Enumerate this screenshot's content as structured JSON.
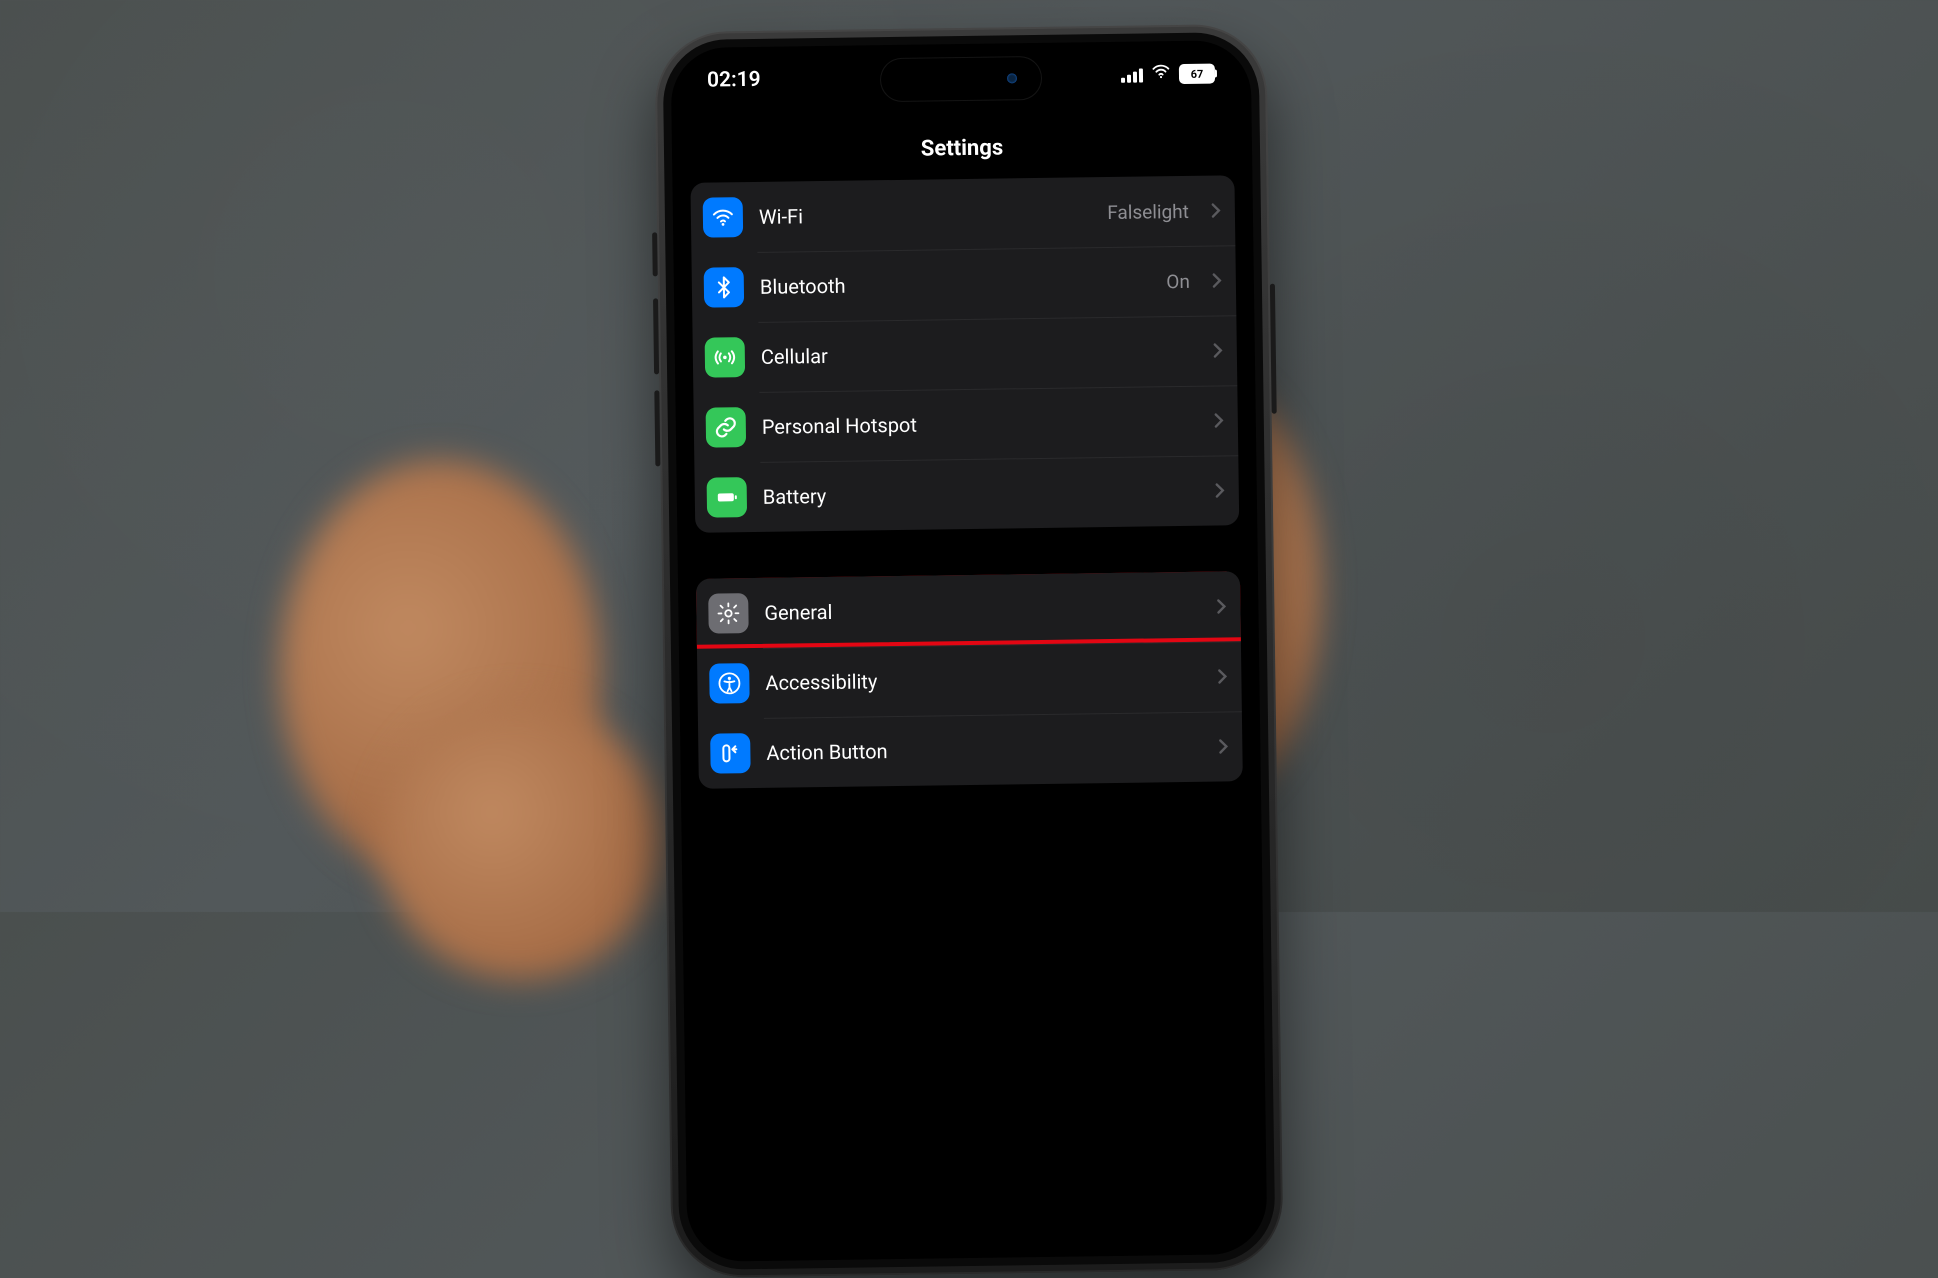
{
  "statusbar": {
    "time": "02:19",
    "battery_percent": "67"
  },
  "header": {
    "title": "Settings"
  },
  "group1": {
    "wifi": {
      "label": "Wi-Fi",
      "value": "Falselight"
    },
    "bluetooth": {
      "label": "Bluetooth",
      "value": "On"
    },
    "cellular": {
      "label": "Cellular",
      "value": ""
    },
    "hotspot": {
      "label": "Personal Hotspot",
      "value": ""
    },
    "battery": {
      "label": "Battery",
      "value": ""
    }
  },
  "group2": {
    "general": {
      "label": "General",
      "value": ""
    },
    "accessibility": {
      "label": "Accessibility",
      "value": ""
    },
    "actionbutton": {
      "label": "Action Button",
      "value": ""
    }
  },
  "highlight": {
    "target": "general"
  }
}
